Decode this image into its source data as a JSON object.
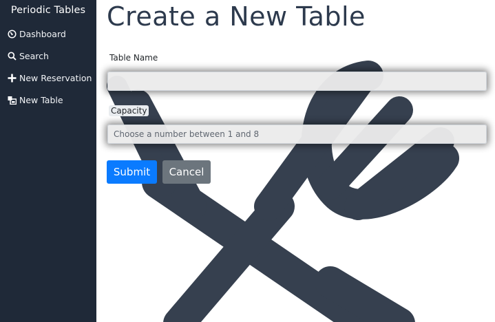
{
  "sidebar": {
    "brand": "Periodic Tables",
    "items": [
      {
        "label": "Dashboard",
        "icon": "dashboard-icon"
      },
      {
        "label": "Search",
        "icon": "search-icon"
      },
      {
        "label": "New Reservation",
        "icon": "plus-icon"
      },
      {
        "label": "New Table",
        "icon": "table-icon"
      }
    ]
  },
  "main": {
    "title": "Create a New Table",
    "form": {
      "table_name_label": "Table Name",
      "table_name_value": "",
      "capacity_label": "Capacity",
      "capacity_placeholder": "Choose a number between 1 and 8",
      "submit_label": "Submit",
      "cancel_label": "Cancel"
    }
  },
  "colors": {
    "sidebar_bg": "#1f2938",
    "art": "#36404f",
    "submit": "#0a7bff",
    "cancel": "#6c757d"
  }
}
